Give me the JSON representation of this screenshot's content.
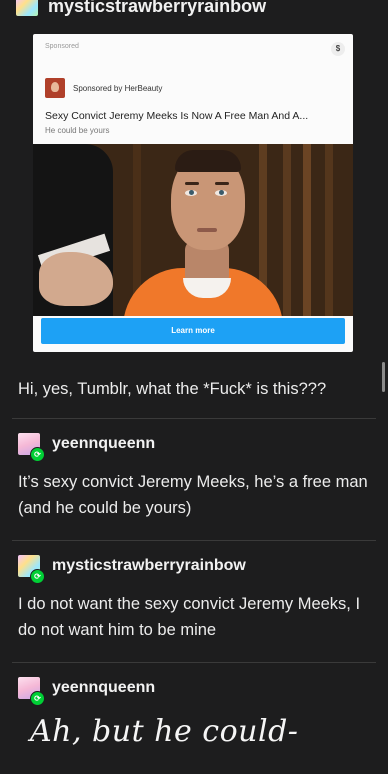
{
  "header": {
    "username": "mysticstrawberryrainbow"
  },
  "ad": {
    "sponsored_label": "Sponsored",
    "dollar_icon": "$",
    "advertiser": "Sponsored by HerBeauty",
    "headline": "Sexy Convict Jeremy Meeks Is Now A Free Man And A...",
    "subline": "He could be yours",
    "cta_label": "Learn more",
    "cta_color": "#1da1f5"
  },
  "comments": [
    {
      "username": "",
      "text": "Hi, yes, Tumblr, what the *Fuck* is this???"
    },
    {
      "username": "yeennqueenn",
      "text": "It’s sexy convict Jeremy Meeks, he’s a free man (and he could be yours)"
    },
    {
      "username": "mysticstrawberryrainbow",
      "text": "I do not want the sexy convict Jeremy Meeks, I do not want him to be mine"
    },
    {
      "username": "yeennqueenn",
      "text": "Ah, but he could-"
    }
  ],
  "colors": {
    "background": "#1d1d1e",
    "reblog_badge": "#00cf35"
  }
}
